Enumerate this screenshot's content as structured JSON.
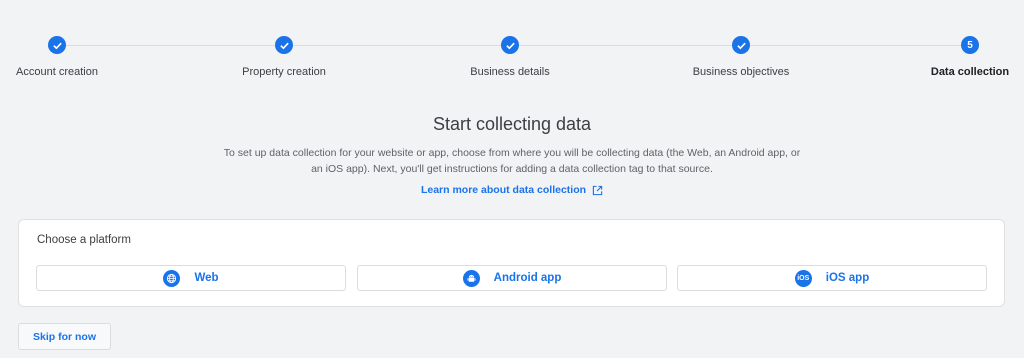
{
  "stepper": {
    "steps": [
      {
        "label": "Account creation",
        "status": "complete",
        "icon": "check-icon"
      },
      {
        "label": "Property creation",
        "status": "complete",
        "icon": "check-icon"
      },
      {
        "label": "Business details",
        "status": "complete",
        "icon": "check-icon"
      },
      {
        "label": "Business objectives",
        "status": "complete",
        "icon": "check-icon"
      },
      {
        "label": "Data collection",
        "status": "current",
        "number": "5"
      }
    ]
  },
  "main": {
    "title": "Start collecting data",
    "description": "To set up data collection for your website or app, choose from where you will be collecting data (the Web, an Android app, or an iOS app). Next, you'll get instructions for adding a data collection tag to that source.",
    "learn_more": "Learn more about data collection"
  },
  "platform_card": {
    "title": "Choose a platform",
    "options": [
      {
        "label": "Web",
        "icon": "globe-icon"
      },
      {
        "label": "Android app",
        "icon": "android-icon"
      },
      {
        "label": "iOS app",
        "icon": "ios-icon",
        "icon_text": "iOS"
      }
    ]
  },
  "footer": {
    "skip_label": "Skip for now"
  },
  "colors": {
    "accent": "#1a73e8",
    "background": "#f1f3f4",
    "card_border": "#e0e0e0"
  }
}
